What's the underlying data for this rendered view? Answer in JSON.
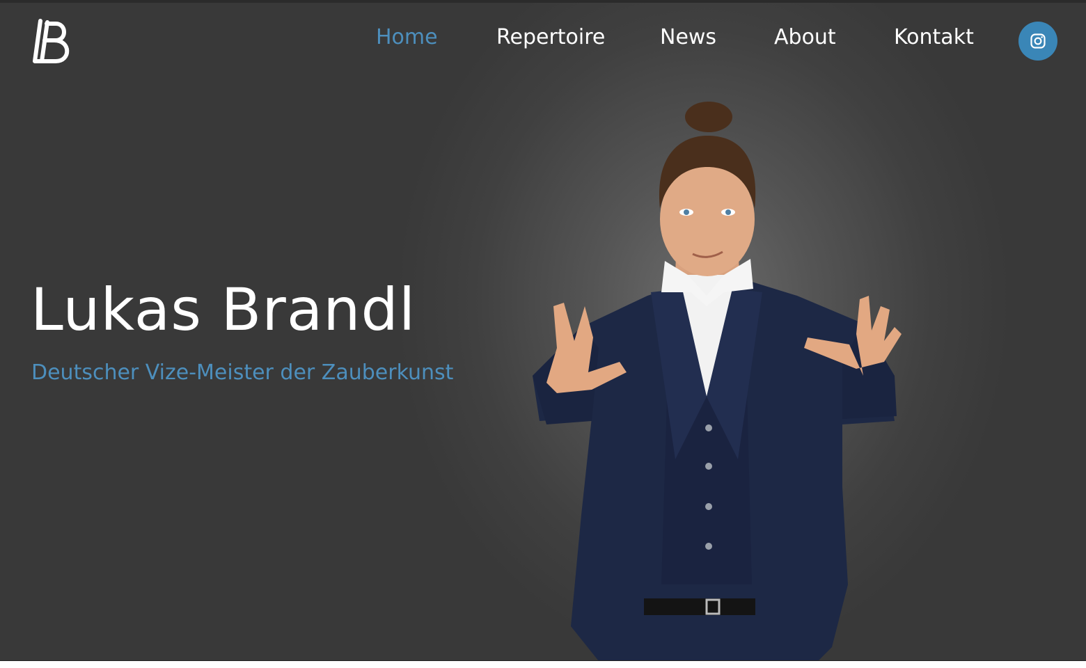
{
  "header": {
    "logo_text": "LB",
    "nav": [
      {
        "label": "Home",
        "active": true
      },
      {
        "label": "Repertoire",
        "active": false
      },
      {
        "label": "News",
        "active": false
      },
      {
        "label": "About",
        "active": false
      },
      {
        "label": "Kontakt",
        "active": false
      }
    ],
    "social_icon": "instagram-icon"
  },
  "hero": {
    "title": "Lukas Brandl",
    "subtitle": "Deutscher Vize-Meister der Zauberkunst",
    "image": "portrait-photo"
  },
  "colors": {
    "accent": "#4d8fbd",
    "instagram_button": "#3a86b7",
    "background": "#404040",
    "text": "#ffffff"
  }
}
